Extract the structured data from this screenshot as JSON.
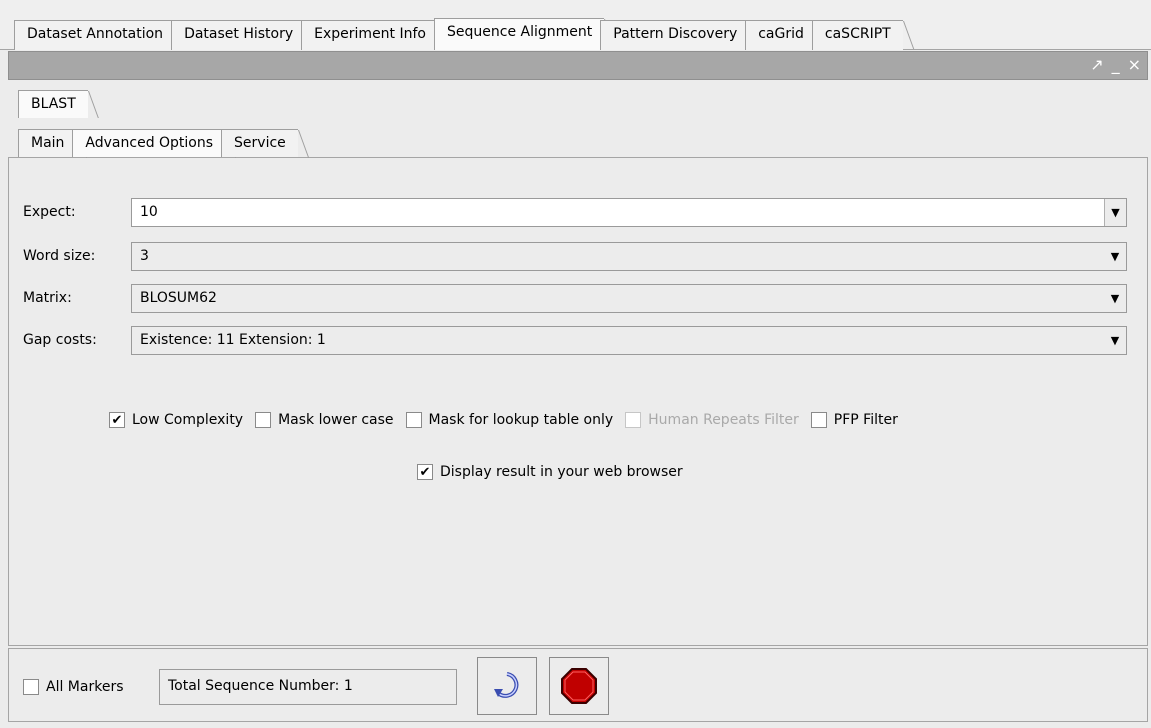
{
  "top_tabs": [
    {
      "label": "Dataset Annotation",
      "active": false
    },
    {
      "label": "Dataset History",
      "active": false
    },
    {
      "label": "Experiment Info",
      "active": false
    },
    {
      "label": "Sequence Alignment",
      "active": true
    },
    {
      "label": "Pattern Discovery",
      "active": false
    },
    {
      "label": "caGrid",
      "active": false
    },
    {
      "label": "caSCRIPT",
      "active": false
    }
  ],
  "window_controls": {
    "maximize": "↗",
    "minimize": "_",
    "close": "×"
  },
  "tool_tabs": [
    {
      "label": "BLAST",
      "active": true
    }
  ],
  "option_tabs": [
    {
      "label": "Main",
      "active": false
    },
    {
      "label": "Advanced Options",
      "active": true
    },
    {
      "label": "Service",
      "active": false
    }
  ],
  "fields": {
    "expect": {
      "label": "Expect:",
      "value": "10"
    },
    "word_size": {
      "label": "Word size:",
      "value": "3"
    },
    "matrix": {
      "label": "Matrix:",
      "value": "BLOSUM62"
    },
    "gap_costs": {
      "label": "Gap costs:",
      "value": "Existence: 11 Extension: 1"
    }
  },
  "filters": [
    {
      "label": "Low Complexity",
      "checked": true,
      "disabled": false
    },
    {
      "label": "Mask lower case",
      "checked": false,
      "disabled": false
    },
    {
      "label": "Mask for lookup table only",
      "checked": false,
      "disabled": false
    },
    {
      "label": "Human Repeats Filter",
      "checked": false,
      "disabled": true
    },
    {
      "label": "PFP Filter",
      "checked": false,
      "disabled": false
    }
  ],
  "display_in_browser": {
    "label": "Display result in your web browser",
    "checked": true
  },
  "footer": {
    "all_markers": {
      "label": "All Markers",
      "checked": false
    },
    "total_sequence": "Total Sequence Number: 1"
  },
  "colors": {
    "stop_red": "#c00000",
    "refresh_blue": "#3a4db0"
  }
}
